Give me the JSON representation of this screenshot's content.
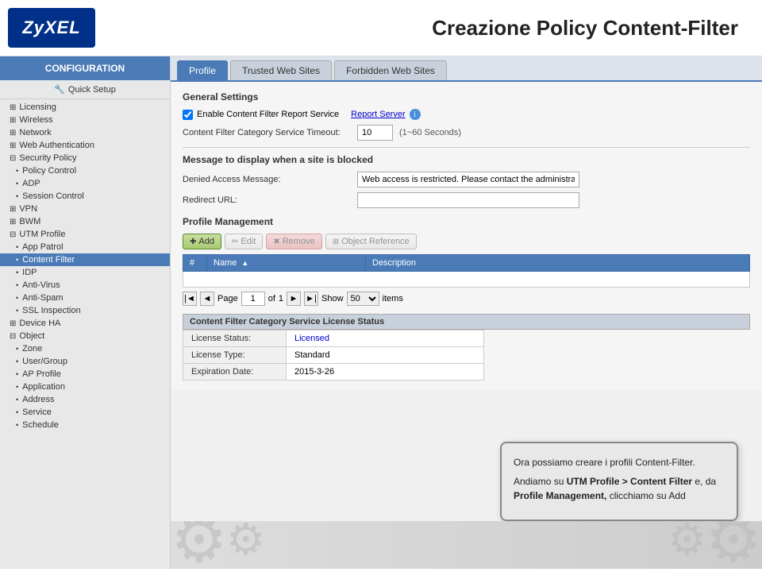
{
  "header": {
    "logo_text": "ZyXEL",
    "page_title": "Creazione Policy Content-Filter"
  },
  "sidebar": {
    "config_header": "CONFIGURATION",
    "quick_setup": "Quick Setup",
    "items": [
      {
        "id": "licensing",
        "label": "Licensing",
        "level": 1,
        "expandable": true
      },
      {
        "id": "wireless",
        "label": "Wireless",
        "level": 1,
        "expandable": true
      },
      {
        "id": "network",
        "label": "Network",
        "level": 1,
        "expandable": true
      },
      {
        "id": "web-auth",
        "label": "Web Authentication",
        "level": 1,
        "expandable": true
      },
      {
        "id": "security-policy",
        "label": "Security Policy",
        "level": 1,
        "expandable": true
      },
      {
        "id": "policy-control",
        "label": "Policy Control",
        "level": 2
      },
      {
        "id": "adp",
        "label": "ADP",
        "level": 2
      },
      {
        "id": "session-control",
        "label": "Session Control",
        "level": 2
      },
      {
        "id": "vpn",
        "label": "VPN",
        "level": 1,
        "expandable": true
      },
      {
        "id": "bwm",
        "label": "BWM",
        "level": 1,
        "expandable": true
      },
      {
        "id": "utm-profile",
        "label": "UTM Profile",
        "level": 1,
        "expandable": true
      },
      {
        "id": "app-patrol",
        "label": "App Patrol",
        "level": 2
      },
      {
        "id": "content-filter",
        "label": "Content Filter",
        "level": 2,
        "active": true
      },
      {
        "id": "idp",
        "label": "IDP",
        "level": 2
      },
      {
        "id": "anti-virus",
        "label": "Anti-Virus",
        "level": 2
      },
      {
        "id": "anti-spam",
        "label": "Anti-Spam",
        "level": 2
      },
      {
        "id": "ssl-inspection",
        "label": "SSL Inspection",
        "level": 2
      },
      {
        "id": "device-ha",
        "label": "Device HA",
        "level": 1,
        "expandable": true
      },
      {
        "id": "object",
        "label": "Object",
        "level": 1,
        "expandable": true
      },
      {
        "id": "zone",
        "label": "Zone",
        "level": 2
      },
      {
        "id": "user-group",
        "label": "User/Group",
        "level": 2
      },
      {
        "id": "ap-profile",
        "label": "AP Profile",
        "level": 2
      },
      {
        "id": "application",
        "label": "Application",
        "level": 2
      },
      {
        "id": "address",
        "label": "Address",
        "level": 2
      },
      {
        "id": "service",
        "label": "Service",
        "level": 2
      },
      {
        "id": "schedule",
        "label": "Schedule",
        "level": 2
      }
    ]
  },
  "tabs": [
    {
      "id": "profile",
      "label": "Profile",
      "active": true
    },
    {
      "id": "trusted",
      "label": "Trusted Web Sites"
    },
    {
      "id": "forbidden",
      "label": "Forbidden Web Sites"
    }
  ],
  "general_settings": {
    "title": "General Settings",
    "enable_label": "Enable Content Filter Report Service",
    "report_server_link": "Report Server",
    "timeout_label": "Content Filter Category Service Timeout:",
    "timeout_value": "10",
    "timeout_hint": "(1~60 Seconds)"
  },
  "block_message": {
    "title": "Message to display when a site is blocked",
    "denied_label": "Denied Access Message:",
    "denied_value": "Web access is restricted. Please contact the administrator.",
    "redirect_label": "Redirect URL:"
  },
  "profile_management": {
    "title": "Profile Management",
    "btn_add": "Add",
    "btn_edit": "Edit",
    "btn_remove": "Remove",
    "btn_object_ref": "Object Reference",
    "col_num": "#",
    "col_name": "Name",
    "col_sort": "▲",
    "col_desc": "Description",
    "page_label": "Page",
    "page_current": "1",
    "page_of": "of",
    "page_total": "1",
    "show_label": "Show",
    "show_value": "50",
    "items_label": "items"
  },
  "license_status": {
    "title": "Content Filter Category Service License Status",
    "status_label": "License Status:",
    "status_value": "Licensed",
    "type_label": "License Type:",
    "type_value": "Standard",
    "expiry_label": "Expiration Date:",
    "expiry_value": "2015-3-26"
  },
  "callout": {
    "line1": "Ora possiamo creare i profili Content-Filter.",
    "line2": "Andiamo su ",
    "bold1": "UTM Profile > Content Filter",
    "line3": " e, da ",
    "bold2": "Profile Management,",
    "line4": " clicchiamo su Add"
  }
}
